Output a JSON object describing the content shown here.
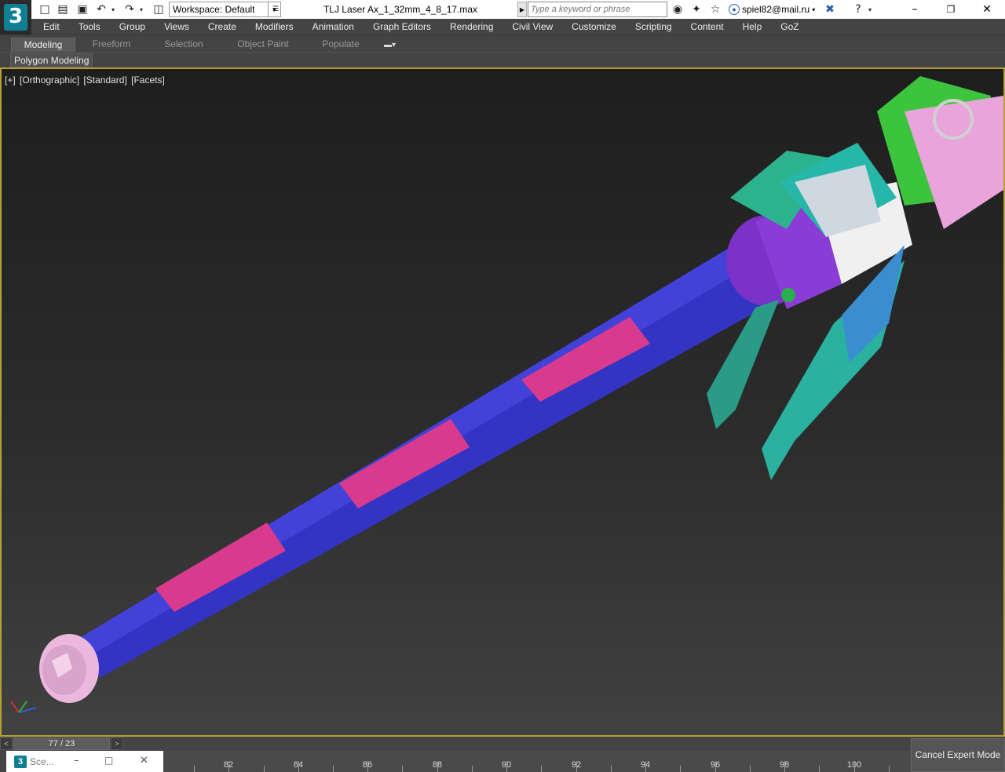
{
  "app": {
    "logo_text": "3",
    "document_title": "TLJ Laser Ax_1_32mm_4_8_17.max",
    "workspace_label": "Workspace: Default",
    "search_placeholder": "Type a keyword or phrase",
    "user": "spiel82@mail.ru",
    "accent_color": "#0f7f94"
  },
  "quick_access": {
    "icons": [
      "new-file-icon",
      "open-file-icon",
      "save-icon",
      "undo-icon",
      "redo-icon",
      "project-folder-icon"
    ]
  },
  "title_icons": [
    "binoculars-icon",
    "star-tools-icon",
    "star-icon",
    "user-icon",
    "x-autodesk-icon",
    "help-icon"
  ],
  "menu": [
    "Edit",
    "Tools",
    "Group",
    "Views",
    "Create",
    "Modifiers",
    "Animation",
    "Graph Editors",
    "Rendering",
    "Civil View",
    "Customize",
    "Scripting",
    "Content",
    "Help",
    "GoZ"
  ],
  "ribbon": {
    "tabs": [
      "Modeling",
      "Freeform",
      "Selection",
      "Object Paint",
      "Populate"
    ],
    "active_tab": "Modeling",
    "panel_label": "Polygon Modeling"
  },
  "viewport": {
    "labels": [
      "[+]",
      "[Orthographic]",
      "[Standard]",
      "[Facets]"
    ],
    "border_color": "#b5a033"
  },
  "time_slider": {
    "frame": "77 / 23",
    "left_arrow": "<",
    "right_arrow": ">"
  },
  "trackbar": {
    "ticks": [
      "82",
      "84",
      "86",
      "88",
      "90",
      "92",
      "94",
      "96",
      "98",
      "100"
    ]
  },
  "scene_explorer": {
    "label": "Sce..."
  },
  "cancel_expert_mode": "Cancel Expert Mode"
}
